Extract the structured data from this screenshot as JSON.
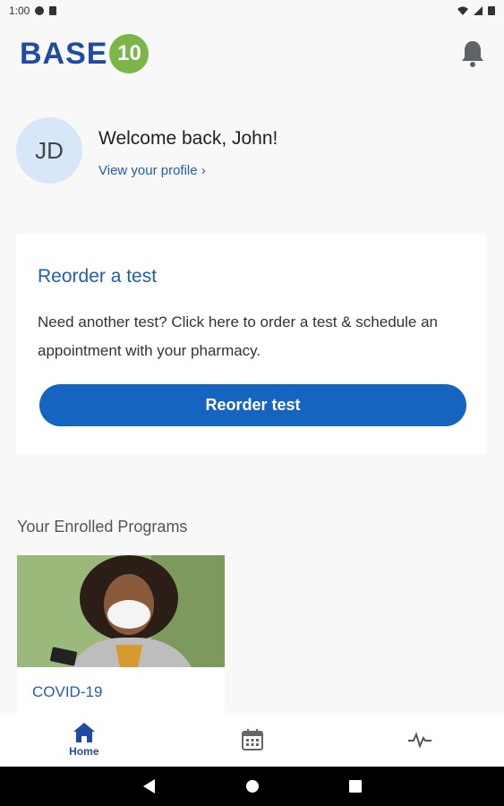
{
  "status_bar": {
    "time": "1:00"
  },
  "header": {
    "logo_text": "BASE",
    "logo_number": "10"
  },
  "profile": {
    "initials": "JD",
    "welcome": "Welcome back, John!",
    "link_label": "View your profile ›"
  },
  "reorder_card": {
    "title": "Reorder a test",
    "description": "Need another test? Click here to order a test & schedule an appointment with your pharmacy.",
    "button_label": "Reorder test"
  },
  "programs": {
    "section_title": "Your Enrolled Programs",
    "items": [
      {
        "name": "COVID-19"
      }
    ]
  },
  "bottom_nav": {
    "items": [
      {
        "label": "Home",
        "icon": "home-icon"
      },
      {
        "label": "",
        "icon": "calendar-icon"
      },
      {
        "label": "",
        "icon": "activity-icon"
      }
    ]
  },
  "colors": {
    "brand_blue": "#1565c0",
    "logo_green": "#7ab648"
  }
}
